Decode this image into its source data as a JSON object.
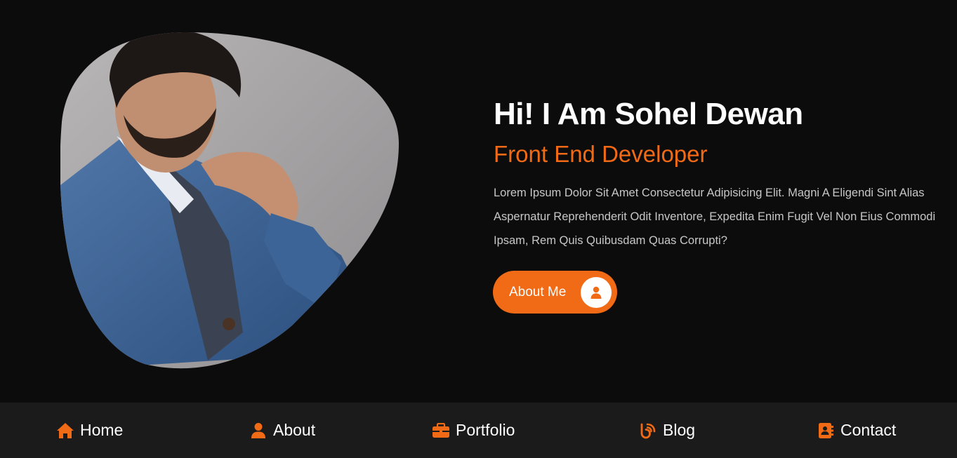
{
  "hero": {
    "heading": "Hi! I Am Sohel Dewan",
    "subheading": "Front End Developer",
    "description": "Lorem Ipsum Dolor Sit Amet Consectetur Adipisicing Elit. Magni A Eligendi Sint Alias Aspernatur Reprehenderit Odit Inventore, Expedita Enim Fugit Vel Non Eius Commodi Ipsam, Rem Quis Quibusdam Quas Corrupti?",
    "button_label": "About Me",
    "button_icon": "user-icon"
  },
  "nav": {
    "items": [
      {
        "label": "Home",
        "icon": "home-icon"
      },
      {
        "label": "About",
        "icon": "user-icon"
      },
      {
        "label": "Portfolio",
        "icon": "briefcase-icon"
      },
      {
        "label": "Blog",
        "icon": "blog-icon"
      },
      {
        "label": "Contact",
        "icon": "address-book-icon"
      }
    ]
  },
  "colors": {
    "accent": "#f16a15",
    "background": "#0d0c0d",
    "nav_background": "#1b1b1b"
  }
}
